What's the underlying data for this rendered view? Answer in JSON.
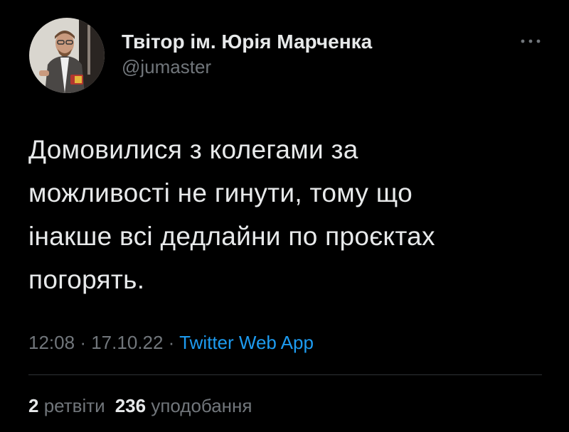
{
  "author": {
    "display_name": "Твітор ім. Юрія Марченка",
    "handle": "@jumaster",
    "avatar_icon": "profile-photo"
  },
  "more_icon": "ellipsis-icon",
  "tweet": {
    "text": "Домовилися з колегами за\nможливості не гинути, тому що\nінакше всі дедлайни по проєктах\nпогорять."
  },
  "meta": {
    "time": "12:08",
    "separator": "·",
    "date": "17.10.22",
    "source": "Twitter Web App"
  },
  "stats": {
    "retweets_count": "2",
    "retweets_label": "ретвіти",
    "likes_count": "236",
    "likes_label": "уподобання"
  },
  "colors": {
    "background": "#000000",
    "text": "#e7e9ea",
    "secondary": "#71767b",
    "link": "#1d9bf0",
    "divider": "#2f3336"
  }
}
